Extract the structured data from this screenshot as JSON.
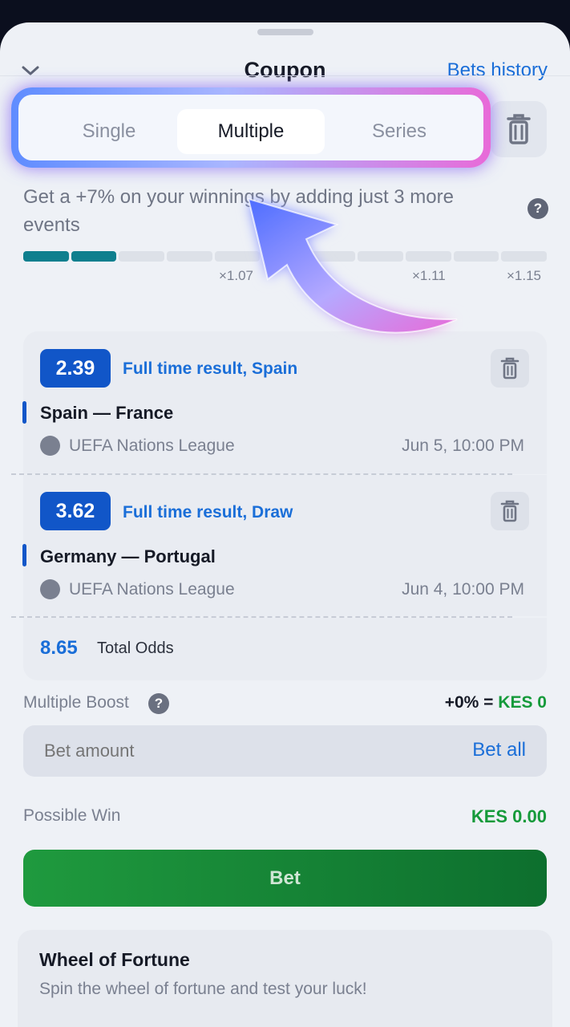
{
  "header": {
    "title": "Coupon",
    "history_label": "Bets history"
  },
  "tabs": [
    {
      "label": "Single",
      "active": false
    },
    {
      "label": "Multiple",
      "active": true
    },
    {
      "label": "Series",
      "active": false
    }
  ],
  "boost_info": {
    "text": "Get a +7% on your winnings by adding just 3 more events"
  },
  "progress": {
    "filled_segments": 2,
    "total_segments": 11,
    "multipliers": [
      "×1.07",
      "×1.11",
      "×1.15"
    ]
  },
  "bets": [
    {
      "odds": "2.39",
      "market": "Full time result, Spain",
      "teams": "Spain — France",
      "league": "UEFA Nations League",
      "date": "Jun 5, 10:00 PM"
    },
    {
      "odds": "3.62",
      "market": "Full time result, Draw",
      "teams": "Germany — Portugal",
      "league": "UEFA Nations League",
      "date": "Jun 4, 10:00 PM"
    }
  ],
  "total": {
    "odds": "8.65",
    "label": "Total Odds"
  },
  "multiple_boost": {
    "label": "Multiple Boost",
    "value_prefix": "+0% = ",
    "value_amount": "KES 0"
  },
  "bet_input": {
    "placeholder": "Bet amount",
    "bet_all_label": "Bet all"
  },
  "possible_win": {
    "label": "Possible Win",
    "value": "KES 0.00"
  },
  "bet_button": {
    "label": "Bet"
  },
  "wheel": {
    "title": "Wheel of Fortune",
    "subtitle": "Spin the wheel of fortune and test your luck!"
  },
  "help_glyph": "?",
  "colors": {
    "accent_blue": "#1a6ed8",
    "badge_blue": "#1156c8",
    "green": "#159a3a",
    "teal": "#0f7f8e"
  }
}
